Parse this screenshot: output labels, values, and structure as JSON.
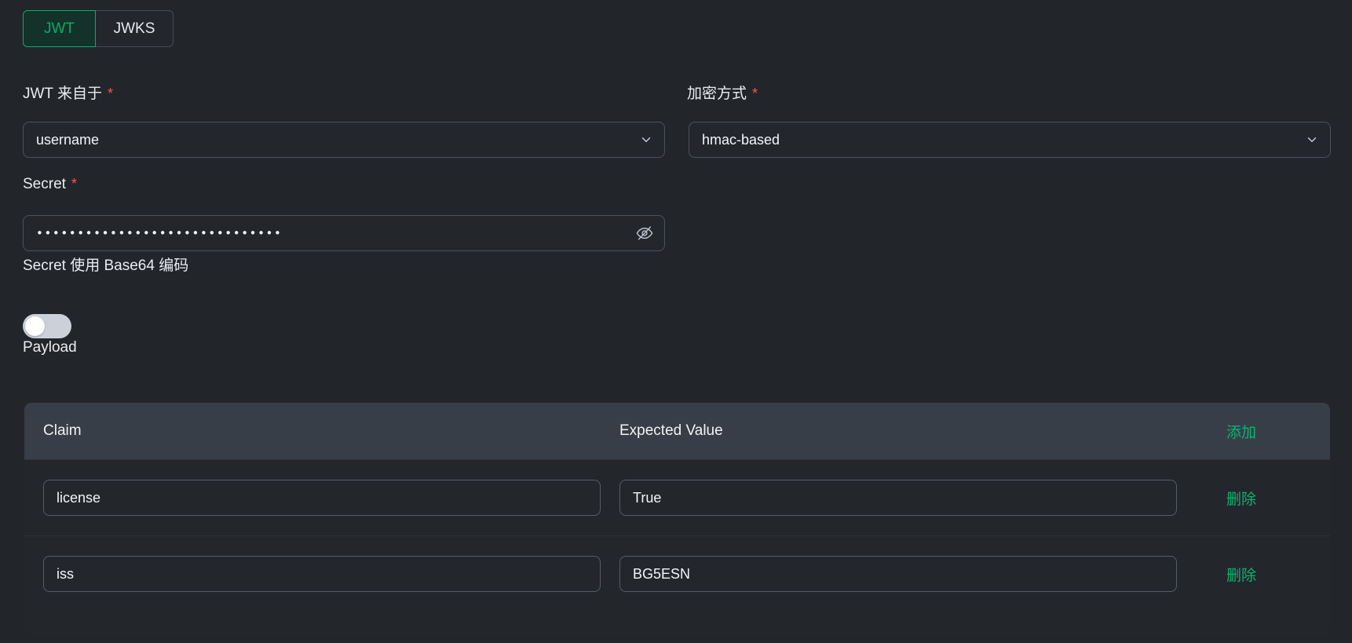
{
  "tabs": [
    {
      "label": "JWT",
      "active": true
    },
    {
      "label": "JWKS",
      "active": false
    }
  ],
  "fields": {
    "jwt_source": {
      "label": "JWT 来自于",
      "required_mark": "*",
      "value": "username"
    },
    "encryption": {
      "label": "加密方式",
      "required_mark": "*",
      "value": "hmac-based"
    },
    "secret": {
      "label": "Secret",
      "required_mark": "*",
      "masked_value": "••••••••••••••••••••••••••••••",
      "toggle_visibility_icon": "eye-off-icon"
    },
    "base64": {
      "label": "Secret 使用 Base64 编码",
      "state": "off"
    }
  },
  "payload": {
    "section_label": "Payload",
    "columns": [
      "Claim",
      "Expected Value"
    ],
    "add_label": "添加",
    "delete_label": "删除",
    "rows": [
      {
        "claim": "license",
        "value": "True",
        "delete_label": "删除"
      },
      {
        "claim": "iss",
        "value": "BG5ESN",
        "delete_label": "删除"
      }
    ]
  },
  "colors": {
    "background": "#22262b",
    "panel": "#23272c",
    "table_header": "#383e48",
    "accent_green": "#0bb471",
    "tab_active_text": "#0bab68",
    "tab_active_bg": "#12322a",
    "required_red": "#f0594f",
    "border": "#4c525b",
    "text": "#f0f3f6"
  }
}
